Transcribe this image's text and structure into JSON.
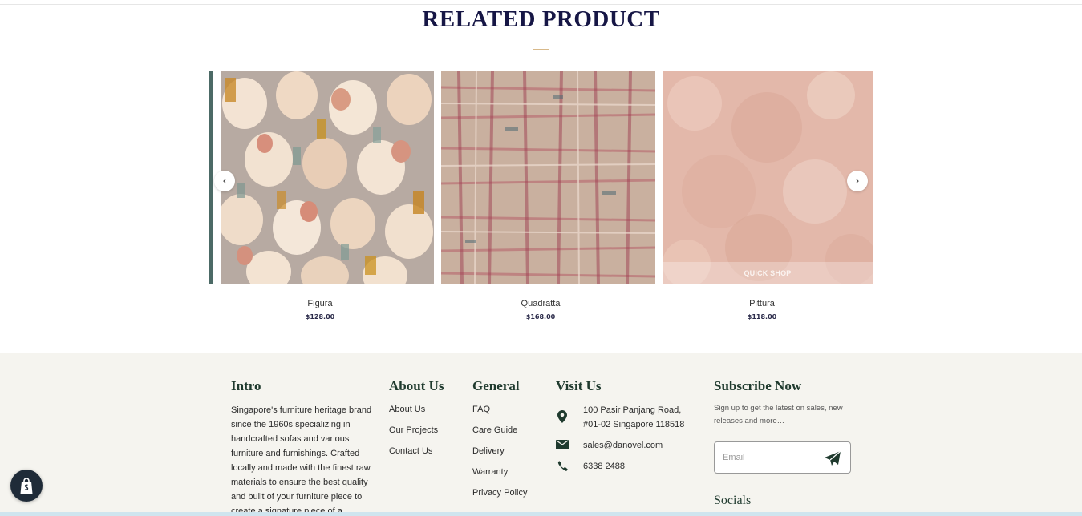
{
  "related": {
    "title": "RELATED PRODUCT",
    "quick_shop_label": "QUICK SHOP",
    "prev_icon": "chevron-left-icon",
    "next_icon": "chevron-right-icon",
    "products": [
      {
        "name": "Figura",
        "price": "$128.00"
      },
      {
        "name": "Quadratta",
        "price": "$168.00"
      },
      {
        "name": "Pittura",
        "price": "$118.00"
      }
    ]
  },
  "footer": {
    "intro": {
      "heading": "Intro",
      "text": "Singapore's furniture heritage brand since the 1960s specializing in handcrafted sofas and various furniture and furnishings. Crafted locally and made with the finest raw materials to ensure the best quality and built of your furniture piece to create a signature piece of a lifetime."
    },
    "about": {
      "heading": "About Us",
      "links": [
        "About Us",
        "Our Projects",
        "Contact Us"
      ]
    },
    "general": {
      "heading": "General",
      "links": [
        "FAQ",
        "Care Guide",
        "Delivery",
        "Warranty",
        "Privacy Policy"
      ]
    },
    "visit": {
      "heading": "Visit Us",
      "address_line1": "100 Pasir Panjang Road,",
      "address_line2": "#01-02 Singapore 118518",
      "email": "sales@danovel.com",
      "phone": "6338 2488"
    },
    "subscribe": {
      "heading": "Subscribe Now",
      "text": "Sign up to get the latest on sales, new releases and more…",
      "email_placeholder": "Email",
      "socials_heading": "Socials"
    }
  },
  "colors": {
    "title": "#161645",
    "footer_bg": "#f5f4ef",
    "footer_heading": "#1f3a2e",
    "accent_line": "#d8b98a"
  }
}
